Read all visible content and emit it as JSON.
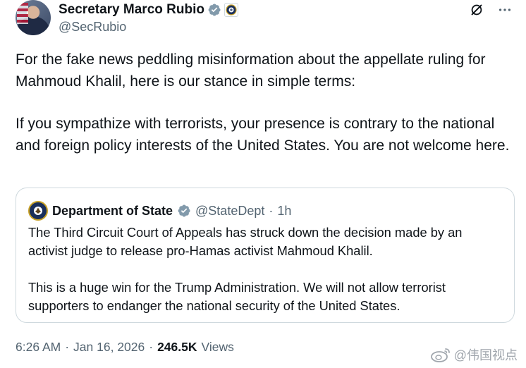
{
  "author": {
    "display_name": "Secretary Marco Rubio",
    "handle": "@SecRubio"
  },
  "tweet": {
    "paragraphs": [
      "For the fake news peddling misinformation about the appellate ruling for Mahmoud Khalil, here is our stance in simple terms:",
      "If you sympathize with terrorists, your presence is contrary to the national and foreign policy interests of the United States. You are not welcome here."
    ]
  },
  "quoted": {
    "display_name": "Department of State",
    "handle": "@StateDept",
    "separator": "·",
    "age": "1h",
    "paragraphs": [
      "The Third Circuit Court of Appeals has struck down the decision made by an activist judge to release pro-Hamas activist Mahmoud Khalil.",
      "This is a huge win for the Trump Administration. We will not allow terrorist supporters to endanger the national security of the United States."
    ]
  },
  "footer": {
    "time": "6:26 AM",
    "sep1": "·",
    "date": "Jan 16, 2026",
    "sep2": "·",
    "views_count": "246.5K",
    "views_label": "Views"
  },
  "watermark": {
    "text": "@伟国视点"
  },
  "icons": {
    "verified": "verified-badge-icon",
    "gov_seal": "government-seal-icon",
    "grok": "grok-icon",
    "more": "more-icon",
    "weibo": "weibo-logo-icon"
  },
  "colors": {
    "verified_gray": "#829aab",
    "text": "#0f1419",
    "muted": "#536471",
    "border": "#cfd9de"
  }
}
